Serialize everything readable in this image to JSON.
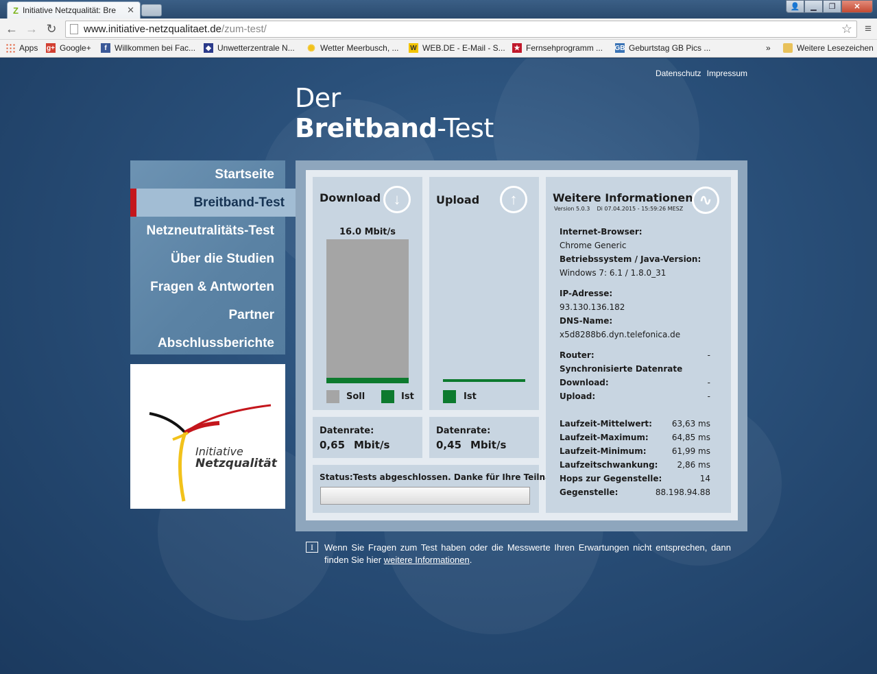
{
  "browser": {
    "tab_title": "Initiative Netzqualität: Bre",
    "tab_favicon": "Z",
    "url_domain": "www.initiative-netzqualitaet.de",
    "url_path": "/zum-test/",
    "bookmarks": [
      {
        "label": "Apps",
        "icon": "apps-grid-icon",
        "color": "#e0522b"
      },
      {
        "label": "Google+",
        "icon": "google-plus-icon",
        "color": "#d23f31"
      },
      {
        "label": "Willkommen bei Fac...",
        "icon": "facebook-icon",
        "color": "#3b5998"
      },
      {
        "label": "Unwetterzentrale N...",
        "icon": "unwetter-icon",
        "color": "#2b3a8a"
      },
      {
        "label": "Wetter Meerbusch, ...",
        "icon": "sun-icon",
        "color": "#f2c21b"
      },
      {
        "label": "WEB.DE - E-Mail - S...",
        "icon": "webde-icon",
        "color": "#f3c400"
      },
      {
        "label": "Fernsehprogramm ...",
        "icon": "tv-star-icon",
        "color": "#c0182b"
      },
      {
        "label": "Geburtstag GB Pics ...",
        "icon": "gb-icon",
        "color": "#3a73b5"
      }
    ],
    "more_bookmarks_chevron": "»",
    "other_bookmarks": "Weitere Lesezeichen"
  },
  "header": {
    "links": [
      "Datenschutz",
      "Impressum"
    ],
    "title_line1": "Der",
    "title_bold": "Breitband",
    "title_rest": "-Test"
  },
  "nav": {
    "items": [
      "Startseite",
      "Breitband-Test",
      "Netzneutralitäts-Test",
      "Über die Studien",
      "Fragen & Antworten",
      "Partner",
      "Abschlussberichte"
    ],
    "active_index": 1
  },
  "logo": {
    "line1": "Initiative",
    "line2": "Netzqualität"
  },
  "download": {
    "title": "Download",
    "bar_label": "16.0 Mbit/s",
    "soll_fraction": 1.0,
    "ist_fraction": 0.04,
    "legend_soll": "Soll",
    "legend_ist": "Ist",
    "rate_label": "Datenrate:",
    "rate_value": "0,65",
    "rate_unit": "Mbit/s"
  },
  "upload": {
    "title": "Upload",
    "legend_ist": "Ist",
    "rate_label": "Datenrate:",
    "rate_value": "0,45",
    "rate_unit": "Mbit/s"
  },
  "status": {
    "label": "Status:",
    "text": "Tests abgeschlossen. Danke für Ihre Teilnahme!"
  },
  "info": {
    "title": "Weitere Informationen",
    "version": "Version 5.0.3",
    "datetime": "Di 07.04.2015 - 15:59:26 MESZ",
    "browser_label": "Internet-Browser:",
    "browser_value": "Chrome Generic",
    "os_label": "Betriebssystem / Java-Version:",
    "os_value": "Windows 7: 6.1 / 1.8.0_31",
    "ip_label": "IP-Adresse:",
    "ip_value": "93.130.136.182",
    "dns_label": "DNS-Name:",
    "dns_value": "x5d8288b6.dyn.telefonica.de",
    "router_label": "Router:",
    "router_value": "-",
    "sync_label": "Synchronisierte Datenrate",
    "sync_download_label": "Download:",
    "sync_download_value": "-",
    "sync_upload_label": "Upload:",
    "sync_upload_value": "-",
    "stats": [
      {
        "label": "Laufzeit-Mittelwert:",
        "value": "63,63 ms"
      },
      {
        "label": "Laufzeit-Maximum:",
        "value": "64,85 ms"
      },
      {
        "label": "Laufzeit-Minimum:",
        "value": "61,99 ms"
      },
      {
        "label": "Laufzeitschwankung:",
        "value": "2,86 ms"
      },
      {
        "label": "Hops zur Gegenstelle:",
        "value": "14"
      },
      {
        "label": "Gegenstelle:",
        "value": "88.198.94.88"
      }
    ]
  },
  "footnote": {
    "icon": "I",
    "text_before": "Wenn Sie Fragen zum Test haben oder die Messwerte Ihren Erwartungen nicht entsprechen, dann finden Sie hier ",
    "link": "weitere Informationen",
    "text_after": "."
  },
  "colors": {
    "accent_red": "#c4161c",
    "bar_ist": "#0d7a2e",
    "bar_soll": "#a5a5a5"
  }
}
